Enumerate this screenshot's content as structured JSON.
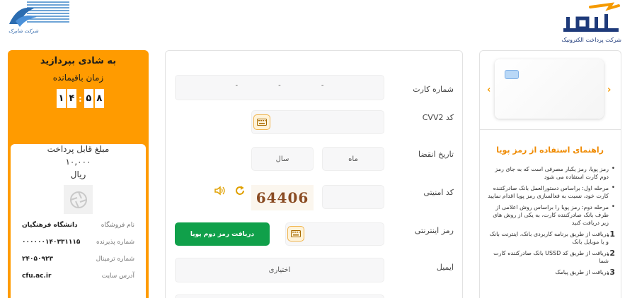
{
  "header": {
    "brand_name": "سداد",
    "brand_subtitle": "شرکت پرداخت الکترونیک",
    "top_left_logo_text": "شرکت شاپرک"
  },
  "timer": {
    "title": "به شادی بپردازید",
    "subtitle": "زمان باقیمانده",
    "digits": [
      "۱",
      "۴",
      "۵",
      "۸"
    ]
  },
  "payment": {
    "amount_label": "مبلغ قابل پرداخت",
    "amount_value": "۱۰,۰۰۰",
    "amount_unit": "ریال",
    "rows": [
      {
        "label": "نام فروشگاه",
        "value": "دانشگاه فرهنگیان"
      },
      {
        "label": "شماره پذیرنده",
        "value": "۰۰۰۰۰۰۱۴۰۳۳۱۱۱۵"
      },
      {
        "label": "شماره ترمینال",
        "value": "۲۴۰۵۰۹۲۳"
      },
      {
        "label": "آدرس سایت",
        "value": "cfu.ac.ir"
      }
    ]
  },
  "form": {
    "card_number_label": "شماره کارت",
    "card_number_dashes": [
      "-",
      "-",
      "-"
    ],
    "cvv2_label": "کد CVV2",
    "expiry_label": "تاریخ انقضا",
    "expiry_month_placeholder": "ماه",
    "expiry_year_placeholder": "سال",
    "captcha_label": "کد امنیتی",
    "captcha_text": "64406",
    "otp_label": "رمز اینترنتی",
    "otp_button": "دریافت رمز دوم پویا",
    "email_label": "ایمیل",
    "email_placeholder": "اختیاری"
  },
  "guide": {
    "title": "راهنمای استفاده از رمز پویا",
    "items": [
      {
        "bullet": "•",
        "text": "رمز پویا، رمز یکبار مصرفی است که به جای رمز دوم کارت استفاده می شود"
      },
      {
        "bullet": "•",
        "text": "مرحله اول: براساس دستورالعمل بانک صادرکننده کارت خود، نسبت به فعالسازی رمز پویا اقدام نمایید"
      },
      {
        "bullet": "•",
        "text": "مرحله دوم: رمز پویا را براساس روش اعلامی از طرف بانک صادرکننده کارت، به یکی از روش های زیر دریافت کنید"
      },
      {
        "bullet": "1.",
        "text": "دریافت از طریق برنامه کاربردی بانک، اینترنت بانک و یا موبایل بانک"
      },
      {
        "bullet": "2.",
        "text": "دریافت از طریق کد USSD بانک صادرکننده کارت شما"
      },
      {
        "bullet": "3.",
        "text": "دریافت از طریق پیامک"
      }
    ]
  },
  "colors": {
    "accent_orange": "#ff9b00",
    "button_green": "#10a04a",
    "brand_navy": "#1e3a7a"
  }
}
